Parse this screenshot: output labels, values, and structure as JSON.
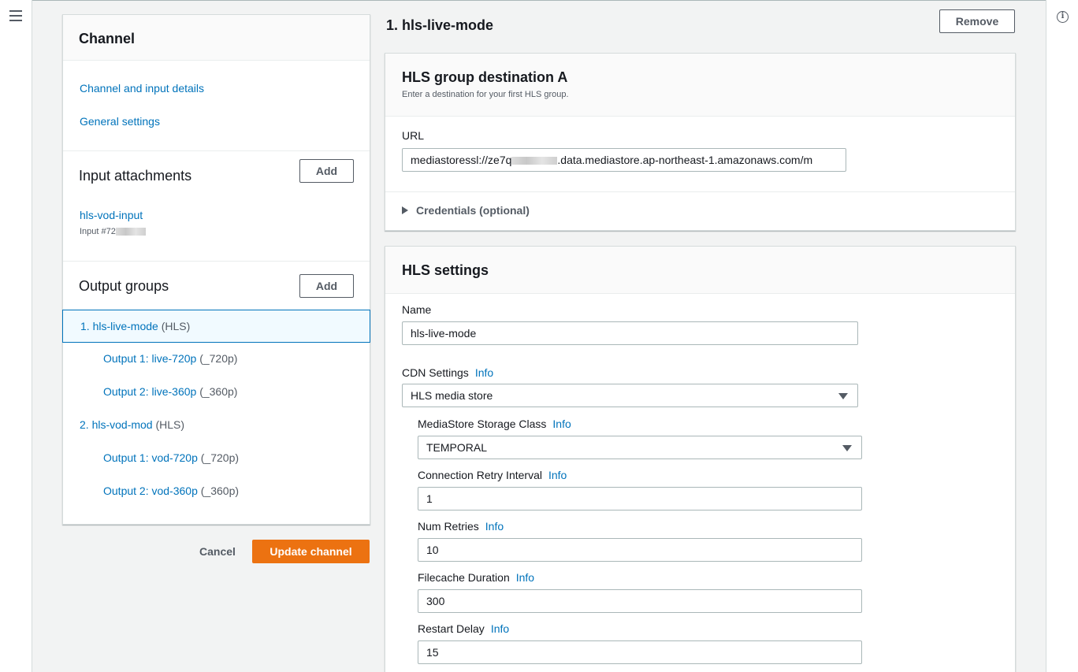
{
  "nav": {
    "title": "Channel",
    "links": [
      "Channel and input details",
      "General settings"
    ],
    "input_attachments": {
      "title": "Input attachments",
      "add_label": "Add",
      "input_name": "hls-vod-input",
      "input_id": "Input #72"
    },
    "output_groups": {
      "title": "Output groups",
      "add_label": "Add",
      "items": [
        {
          "label": "1. hls-live-mode",
          "type": "(HLS)"
        },
        {
          "label": "Output 1: live-720p",
          "type": "(_720p)"
        },
        {
          "label": "Output 2: live-360p",
          "type": "(_360p)"
        },
        {
          "label": "2. hls-vod-mod",
          "type": "(HLS)"
        },
        {
          "label": "Output 1: vod-720p",
          "type": "(_720p)"
        },
        {
          "label": "Output 2: vod-360p",
          "type": "(_360p)"
        }
      ]
    }
  },
  "actions": {
    "cancel": "Cancel",
    "update": "Update channel"
  },
  "main": {
    "title": "1. hls-live-mode",
    "remove": "Remove",
    "destination": {
      "title": "HLS group destination A",
      "description": "Enter a destination for your first HLS group.",
      "url_label": "URL",
      "url_prefix": "mediastoressl://ze7q",
      "url_suffix": ".data.mediastore.ap-northeast-1.amazonaws.com/m",
      "credentials": "Credentials (optional)"
    },
    "hls_settings": {
      "title": "HLS settings",
      "info": "Info",
      "name_label": "Name",
      "name_value": "hls-live-mode",
      "cdn_label": "CDN Settings",
      "cdn_value": "HLS media store",
      "storage_label": "MediaStore Storage Class",
      "storage_value": "TEMPORAL",
      "retry_interval_label": "Connection Retry Interval",
      "retry_interval_value": "1",
      "num_retries_label": "Num Retries",
      "num_retries_value": "10",
      "filecache_label": "Filecache Duration",
      "filecache_value": "300",
      "restart_label": "Restart Delay",
      "restart_value": "15"
    }
  },
  "colors": {
    "accent": "#0073bb",
    "primary_button": "#ec7211"
  }
}
